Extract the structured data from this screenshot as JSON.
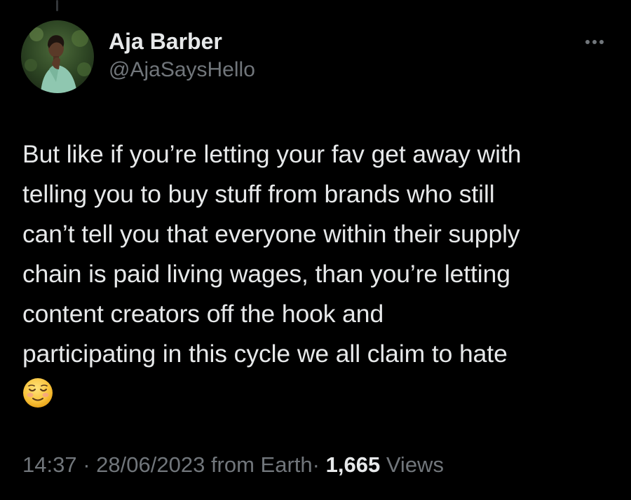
{
  "tweet": {
    "author": {
      "display_name": "Aja Barber",
      "handle": "@AjaSaysHello"
    },
    "more_icon": "ellipsis-horizontal-icon",
    "text": "But like if you’re letting your fav get away with\ntelling you to buy stuff from brands who still\ncan’t tell you that everyone within their supply\nchain is paid living wages, than you’re letting\ncontent creators off the hook and\nparticipating in this cycle we all claim to hate",
    "emoji": "relieved-face-emoji",
    "meta": {
      "time": "14:37",
      "separator": "·",
      "date": "28/06/2023",
      "source": "from Earth",
      "views_count": "1,665",
      "views_label": "Views"
    }
  },
  "colors": {
    "background": "#000000",
    "primary_text": "#e7e9ea",
    "secondary_text": "#71767b"
  }
}
